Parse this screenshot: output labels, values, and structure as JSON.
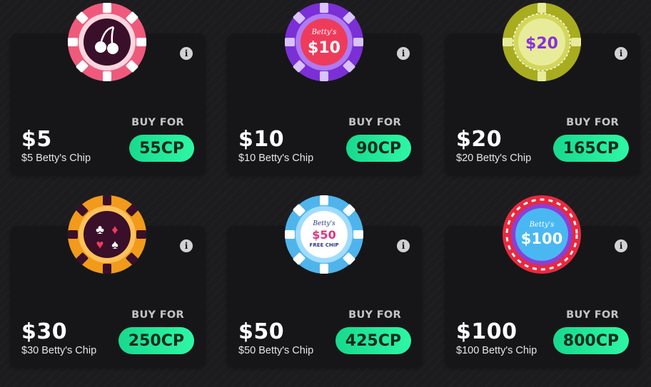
{
  "buy_for_label": "BUY FOR",
  "chips": [
    {
      "price": "$5",
      "name": "$5 Betty's Chip",
      "cost": "55CP",
      "chip_text": "",
      "chip_brand": "",
      "chip_icon": "cherries-icon",
      "rim_color": "#ef5a7c",
      "band_color": "#ffd6de",
      "center_color": "#3a0f2a"
    },
    {
      "price": "$10",
      "name": "$10 Betty's Chip",
      "cost": "90CP",
      "chip_text": "$10",
      "chip_brand": "Betty's",
      "chip_icon": "",
      "rim_color": "#7b2fd6",
      "band_color": "#b07af2",
      "center_color": "#ee3b5c"
    },
    {
      "price": "$20",
      "name": "$20 Betty's Chip",
      "cost": "165CP",
      "chip_text": "$20",
      "chip_brand": "",
      "chip_icon": "",
      "rim_color": "#a8ac1f",
      "band_color": "#d3d65a",
      "center_color": "#e8ec9a"
    },
    {
      "price": "$30",
      "name": "$30 Betty's Chip",
      "cost": "250CP",
      "chip_text": "",
      "chip_brand": "",
      "chip_icon": "card-suits-icon",
      "rim_color": "#f29a1b",
      "band_color": "#ffc15a",
      "center_color": "#3a0f2a"
    },
    {
      "price": "$50",
      "name": "$50 Betty's Chip",
      "cost": "425CP",
      "chip_text": "$50",
      "chip_brand": "Betty's",
      "chip_sub": "FREE CHIP",
      "chip_icon": "",
      "rim_color": "#4fb4ec",
      "band_color": "#9fdcff",
      "center_color": "#ffffff"
    },
    {
      "price": "$100",
      "name": "$100 Betty's Chip",
      "cost": "800CP",
      "chip_text": "$100",
      "chip_brand": "Betty's",
      "chip_icon": "",
      "rim_color": "#e8293f",
      "band_color": "#8b3fd6",
      "center_color": "#49b8f2"
    }
  ]
}
